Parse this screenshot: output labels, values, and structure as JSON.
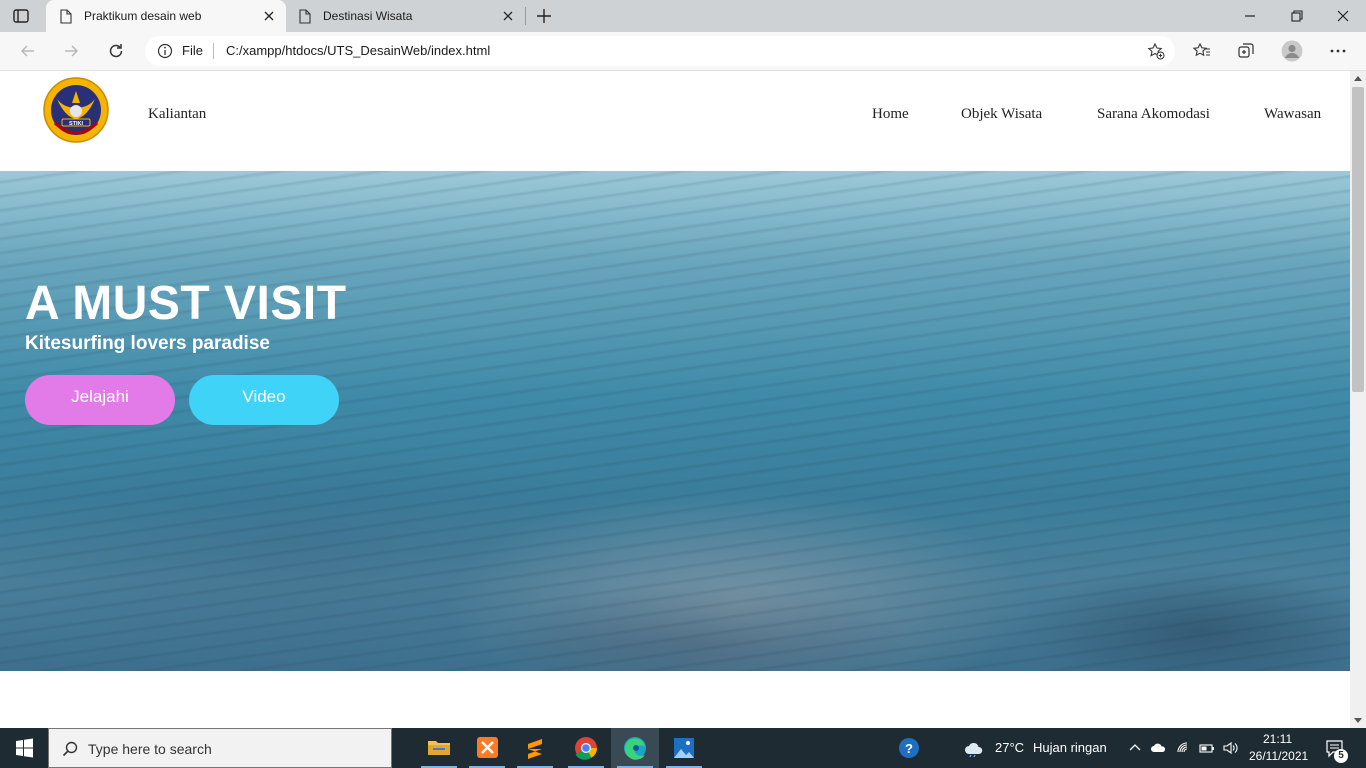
{
  "browser": {
    "tabs": [
      {
        "title": "Praktikum desain web",
        "active": true
      },
      {
        "title": "Destinasi Wisata",
        "active": false
      }
    ],
    "address": {
      "scheme_label": "File",
      "url": "C:/xampp/htdocs/UTS_DesainWeb/index.html"
    }
  },
  "site": {
    "logo_text": "STIKI INDONESIA",
    "brand": "Kaliantan",
    "menu": [
      "Home",
      "Objek Wisata",
      "Sarana Akomodasi",
      "Wawasan"
    ],
    "hero": {
      "title": "A MUST VISIT",
      "subtitle": "Kitesurfing lovers paradise",
      "buttons": [
        "Jelajahi",
        "Video"
      ]
    }
  },
  "colors": {
    "explore_button": "#e27ae8",
    "video_button": "#3fd3f7",
    "accent_green": "#2fb52f"
  },
  "taskbar": {
    "search_placeholder": "Type here to search",
    "apps": [
      "file-explorer",
      "xampp",
      "sublime-text",
      "chrome",
      "edge",
      "photos"
    ],
    "weather_temp": "27°C",
    "weather_desc": "Hujan ringan",
    "time": "21:11",
    "date": "26/11/2021",
    "notifications": "5"
  }
}
